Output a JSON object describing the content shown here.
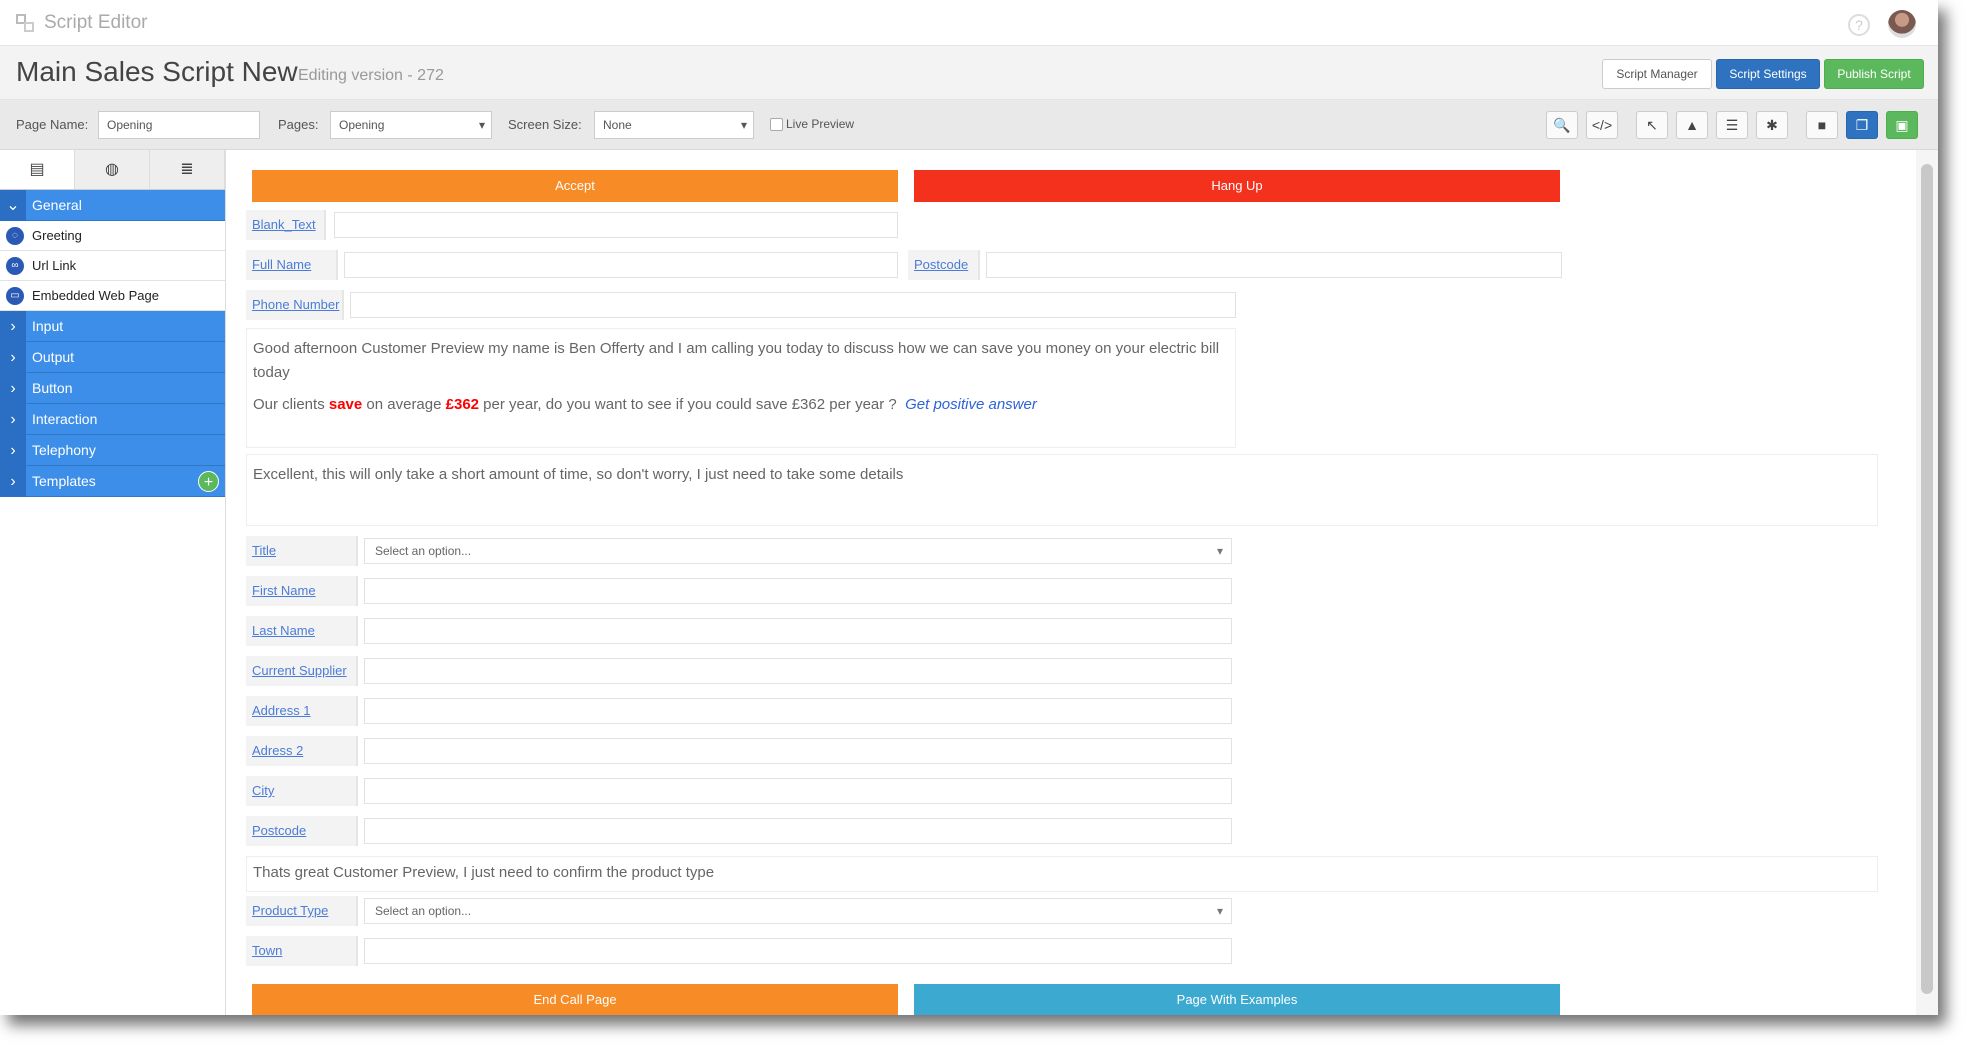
{
  "app": {
    "title": "Script Editor"
  },
  "header": {
    "script_title": "Main Sales Script New",
    "version_label": "Editing version - 272",
    "buttons": {
      "script_manager": "Script Manager",
      "script_settings": "Script Settings",
      "publish_script": "Publish Script"
    }
  },
  "toolbar": {
    "page_name_label": "Page Name:",
    "page_name_value": "Opening",
    "pages_label": "Pages:",
    "pages_value": "Opening",
    "screen_size_label": "Screen Size:",
    "screen_size_value": "None",
    "live_preview_label": "Live Preview",
    "icons": [
      "zoom-icon",
      "code-icon",
      "pointer-icon",
      "bell-icon",
      "align-icon",
      "gear-icon",
      "file-icon",
      "copy-icon",
      "save-icon"
    ]
  },
  "sidebar": {
    "tabs": [
      "elements-tab",
      "globe-tab",
      "database-tab"
    ],
    "general": {
      "label": "General",
      "items": [
        {
          "label": "Greeting",
          "icon": "chat-icon"
        },
        {
          "label": "Url Link",
          "icon": "link-icon"
        },
        {
          "label": "Embedded Web Page",
          "icon": "monitor-icon"
        }
      ]
    },
    "categories": [
      "Input",
      "Output",
      "Button",
      "Interaction",
      "Telephony",
      "Templates"
    ]
  },
  "canvas": {
    "accept_button": "Accept",
    "hangup_button": "Hang Up",
    "fields_top": [
      {
        "label": "Blank_Text",
        "value": ""
      },
      {
        "label": "Full Name",
        "value": ""
      },
      {
        "label": "Postcode",
        "value": ""
      },
      {
        "label": "Phone Number",
        "value": ""
      }
    ],
    "greeting_text": "Good afternoon Customer Preview my name is Ben Offerty and I am calling you today to discuss how we can save you money on your electric bill today",
    "saving_text": {
      "part1": "Our clients ",
      "save": "save",
      "part2": " on average ",
      "amount": "£362",
      "part3": " per year, do you want to see if you could save £362 per year ?",
      "link": "Get positive answer"
    },
    "excellent_text": "Excellent, this will only take a short amount of time, so don't worry, I just need to take some details",
    "form_fields": [
      {
        "label": "Title",
        "value": "Select an option...",
        "type": "select"
      },
      {
        "label": "First Name",
        "value": "",
        "type": "text"
      },
      {
        "label": "Last Name",
        "value": "",
        "type": "text"
      },
      {
        "label": "Current Supplier",
        "value": "",
        "type": "text"
      },
      {
        "label": "Address 1",
        "value": "",
        "type": "text"
      },
      {
        "label": "Adress 2",
        "value": "",
        "type": "text"
      },
      {
        "label": "City",
        "value": "",
        "type": "text"
      },
      {
        "label": "Postcode",
        "value": "",
        "type": "text"
      }
    ],
    "confirm_text": "Thats great Customer Preview, I just need to confirm the product type",
    "product_fields": [
      {
        "label": "Product Type",
        "value": "Select an option...",
        "type": "select"
      },
      {
        "label": "Town",
        "value": "",
        "type": "text"
      }
    ],
    "end_call_button": "End Call Page",
    "examples_button": "Page With Examples"
  }
}
